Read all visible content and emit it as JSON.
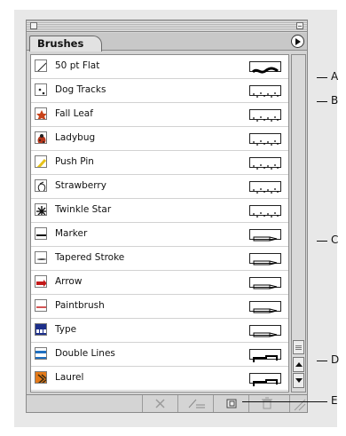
{
  "panel": {
    "tab_label": "Brushes"
  },
  "brushes": [
    {
      "name": "50 pt Flat",
      "brush_type": "calligraphic"
    },
    {
      "name": "Dog Tracks",
      "brush_type": "scatter"
    },
    {
      "name": "Fall Leaf",
      "brush_type": "scatter"
    },
    {
      "name": "Ladybug",
      "brush_type": "scatter"
    },
    {
      "name": "Push Pin",
      "brush_type": "scatter"
    },
    {
      "name": "Strawberry",
      "brush_type": "scatter"
    },
    {
      "name": "Twinkle Star",
      "brush_type": "scatter"
    },
    {
      "name": "Marker",
      "brush_type": "art"
    },
    {
      "name": "Tapered Stroke",
      "brush_type": "art"
    },
    {
      "name": "Arrow",
      "brush_type": "art"
    },
    {
      "name": "Paintbrush",
      "brush_type": "art"
    },
    {
      "name": "Type",
      "brush_type": "art"
    },
    {
      "name": "Double Lines",
      "brush_type": "pattern"
    },
    {
      "name": "Laurel",
      "brush_type": "pattern"
    }
  ],
  "callouts": [
    "A",
    "B",
    "C",
    "D",
    "E"
  ],
  "bottom_buttons": [
    "remove-brush-stroke-icon",
    "brush-options-icon",
    "new-brush-icon",
    "delete-brush-icon"
  ]
}
